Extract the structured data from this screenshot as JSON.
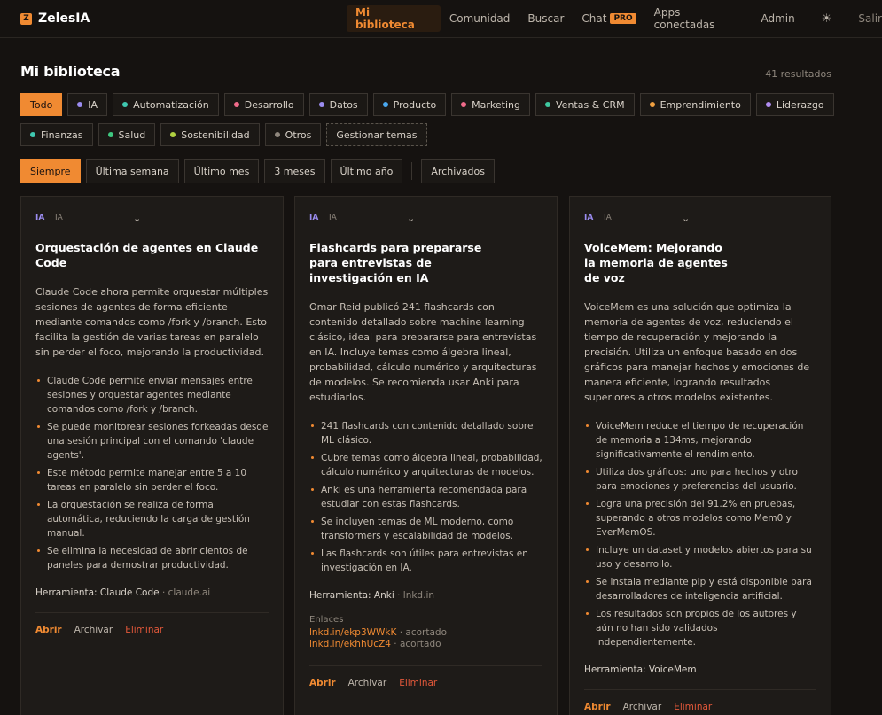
{
  "app": {
    "name": "ZelesIA",
    "logo_glyph": "Z"
  },
  "nav": {
    "links": [
      {
        "label": "Mi biblioteca",
        "active": true
      },
      {
        "label": "Comunidad"
      },
      {
        "label": "Buscar"
      },
      {
        "label": "Chat",
        "badge": "PRO"
      },
      {
        "label": "Apps conectadas"
      },
      {
        "label": "Admin"
      }
    ],
    "theme_icon": "☀",
    "logout": "Salir"
  },
  "page": {
    "title": "Mi biblioteca",
    "results": "41 resultados"
  },
  "topics_row1": [
    {
      "label": "Todo",
      "active": true
    },
    {
      "label": "IA",
      "color": "#9b8cf0"
    },
    {
      "label": "Automatización",
      "color": "#3fc8b0"
    },
    {
      "label": "Desarrollo",
      "color": "#f06b8a"
    },
    {
      "label": "Datos",
      "color": "#9b8cf0"
    },
    {
      "label": "Producto",
      "color": "#4aa8f0"
    },
    {
      "label": "Marketing",
      "color": "#f06b8a"
    },
    {
      "label": "Ventas & CRM",
      "color": "#3fc8a0"
    },
    {
      "label": "Emprendimiento",
      "color": "#f0a040"
    },
    {
      "label": "Liderazgo",
      "color": "#b08cf0"
    }
  ],
  "topics_row2": [
    {
      "label": "Finanzas",
      "color": "#3fc8b0"
    },
    {
      "label": "Salud",
      "color": "#3fc880"
    },
    {
      "label": "Sostenibilidad",
      "color": "#b0d040"
    },
    {
      "label": "Otros",
      "color": "#8f877d"
    },
    {
      "label": "Gestionar temas",
      "dashed": true
    }
  ],
  "time_filters": [
    {
      "label": "Siempre",
      "active": true
    },
    {
      "label": "Última semana"
    },
    {
      "label": "Último mes"
    },
    {
      "label": "3 meses"
    },
    {
      "label": "Último año"
    },
    {
      "label": "Archivados",
      "separated": true
    }
  ],
  "cards": [
    {
      "badge": "IA",
      "category": "IA",
      "title": "Orquestación de agentes en Claude Code",
      "summary": "Claude Code ahora permite orquestar múltiples sesiones de agentes de forma eficiente mediante comandos como /fork y /branch. Esto facilita la gestión de varias tareas en paralelo sin perder el foco, mejorando la productividad.",
      "bullets": [
        "Claude Code permite enviar mensajes entre sesiones y orquestar agentes mediante comandos como /fork y /branch.",
        "Se puede monitorear sesiones forkeadas desde una sesión principal con el comando 'claude agents'.",
        "Este método permite manejar entre 5 a 10 tareas en paralelo sin perder el foco.",
        "La orquestación se realiza de forma automática, reduciendo la carga de gestión manual.",
        "Se elimina la necesidad de abrir cientos de paneles para demostrar productividad."
      ],
      "tool": "Herramienta: Claude Code",
      "tool_domain": "· claude.ai",
      "links_label": "",
      "links": [],
      "actions": {
        "open": "Abrir",
        "archive": "Archivar",
        "delete": "Eliminar"
      }
    },
    {
      "badge": "IA",
      "category": "IA",
      "title": "Flashcards para prepararse para entrevistas de investigación en IA",
      "summary": "Omar Reid publicó 241 flashcards con contenido detallado sobre machine learning clásico, ideal para prepararse para entrevistas en IA. Incluye temas como álgebra lineal, probabilidad, cálculo numérico y arquitecturas de modelos. Se recomienda usar Anki para estudiarlos.",
      "bullets": [
        "241 flashcards con contenido detallado sobre ML clásico.",
        "Cubre temas como álgebra lineal, probabilidad, cálculo numérico y arquitecturas de modelos.",
        "Anki es una herramienta recomendada para estudiar con estas flashcards.",
        "Se incluyen temas de ML moderno, como transformers y escalabilidad de modelos.",
        "Las flashcards son útiles para entrevistas en investigación en IA."
      ],
      "tool": "Herramienta: Anki",
      "tool_domain": "· lnkd.in",
      "links_label": "Enlaces",
      "links": [
        {
          "url": "lnkd.in/ekp3WWkK",
          "note": "· acortado"
        },
        {
          "url": "lnkd.in/ekhhUcZ4",
          "note": "· acortado"
        }
      ],
      "actions": {
        "open": "Abrir",
        "archive": "Archivar",
        "delete": "Eliminar"
      }
    },
    {
      "badge": "IA",
      "category": "IA",
      "title": "VoiceMem: Mejorando la memoria de agentes de voz",
      "summary": "VoiceMem es una solución que optimiza la memoria de agentes de voz, reduciendo el tiempo de recuperación y mejorando la precisión. Utiliza un enfoque basado en dos gráficos para manejar hechos y emociones de manera eficiente, logrando resultados superiores a otros modelos existentes.",
      "bullets": [
        "VoiceMem reduce el tiempo de recuperación de memoria a 134ms, mejorando significativamente el rendimiento.",
        "Utiliza dos gráficos: uno para hechos y otro para emociones y preferencias del usuario.",
        "Logra una precisión del 91.2% en pruebas, superando a otros modelos como Mem0 y EverMemOS.",
        "Incluye un dataset y modelos abiertos para su uso y desarrollo.",
        "Se instala mediante pip y está disponible para desarrolladores de inteligencia artificial.",
        "Los resultados son propios de los autores y aún no han sido validados independientemente."
      ],
      "tool": "Herramienta: VoiceMem",
      "tool_domain": "",
      "links_label": "",
      "links": [],
      "actions": {
        "open": "Abrir",
        "archive": "Archivar",
        "delete": "Eliminar"
      }
    }
  ]
}
